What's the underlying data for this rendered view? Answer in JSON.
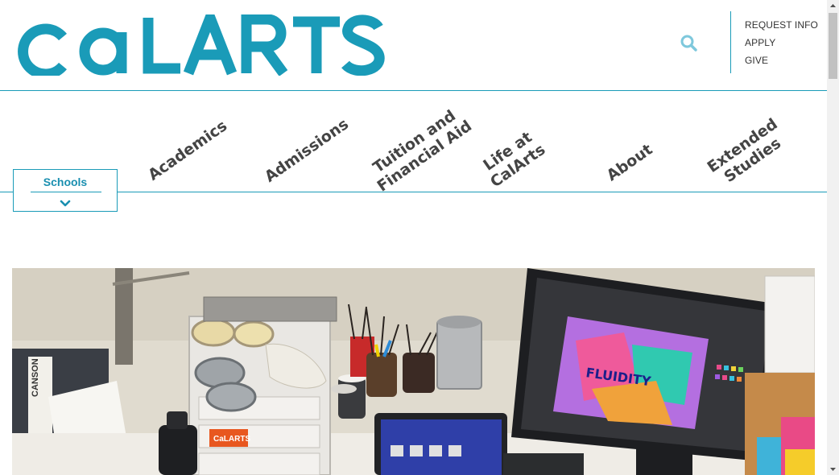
{
  "header": {
    "logo_text": "CaLARTS",
    "brand_color": "#1a9bb8",
    "search_icon": "search-icon"
  },
  "utility_nav": {
    "items": [
      {
        "label": "REQUEST INFO"
      },
      {
        "label": "APPLY"
      },
      {
        "label": "GIVE"
      }
    ]
  },
  "main_nav": {
    "items": [
      {
        "line1": "Academics"
      },
      {
        "line1": "Admissions"
      },
      {
        "line1": "Tuition and",
        "line2": "Financial Aid"
      },
      {
        "line1": "Life at",
        "line2": "CalArts"
      },
      {
        "line1": "About"
      },
      {
        "line1": "Extended",
        "line2": "Studies"
      }
    ]
  },
  "schools": {
    "label": "Schools",
    "icon": "chevron-down-icon"
  },
  "hero": {
    "screen_text": "FLUIDITY",
    "laptop_sticker": "CaLARTS",
    "box_text": "CANSON"
  }
}
